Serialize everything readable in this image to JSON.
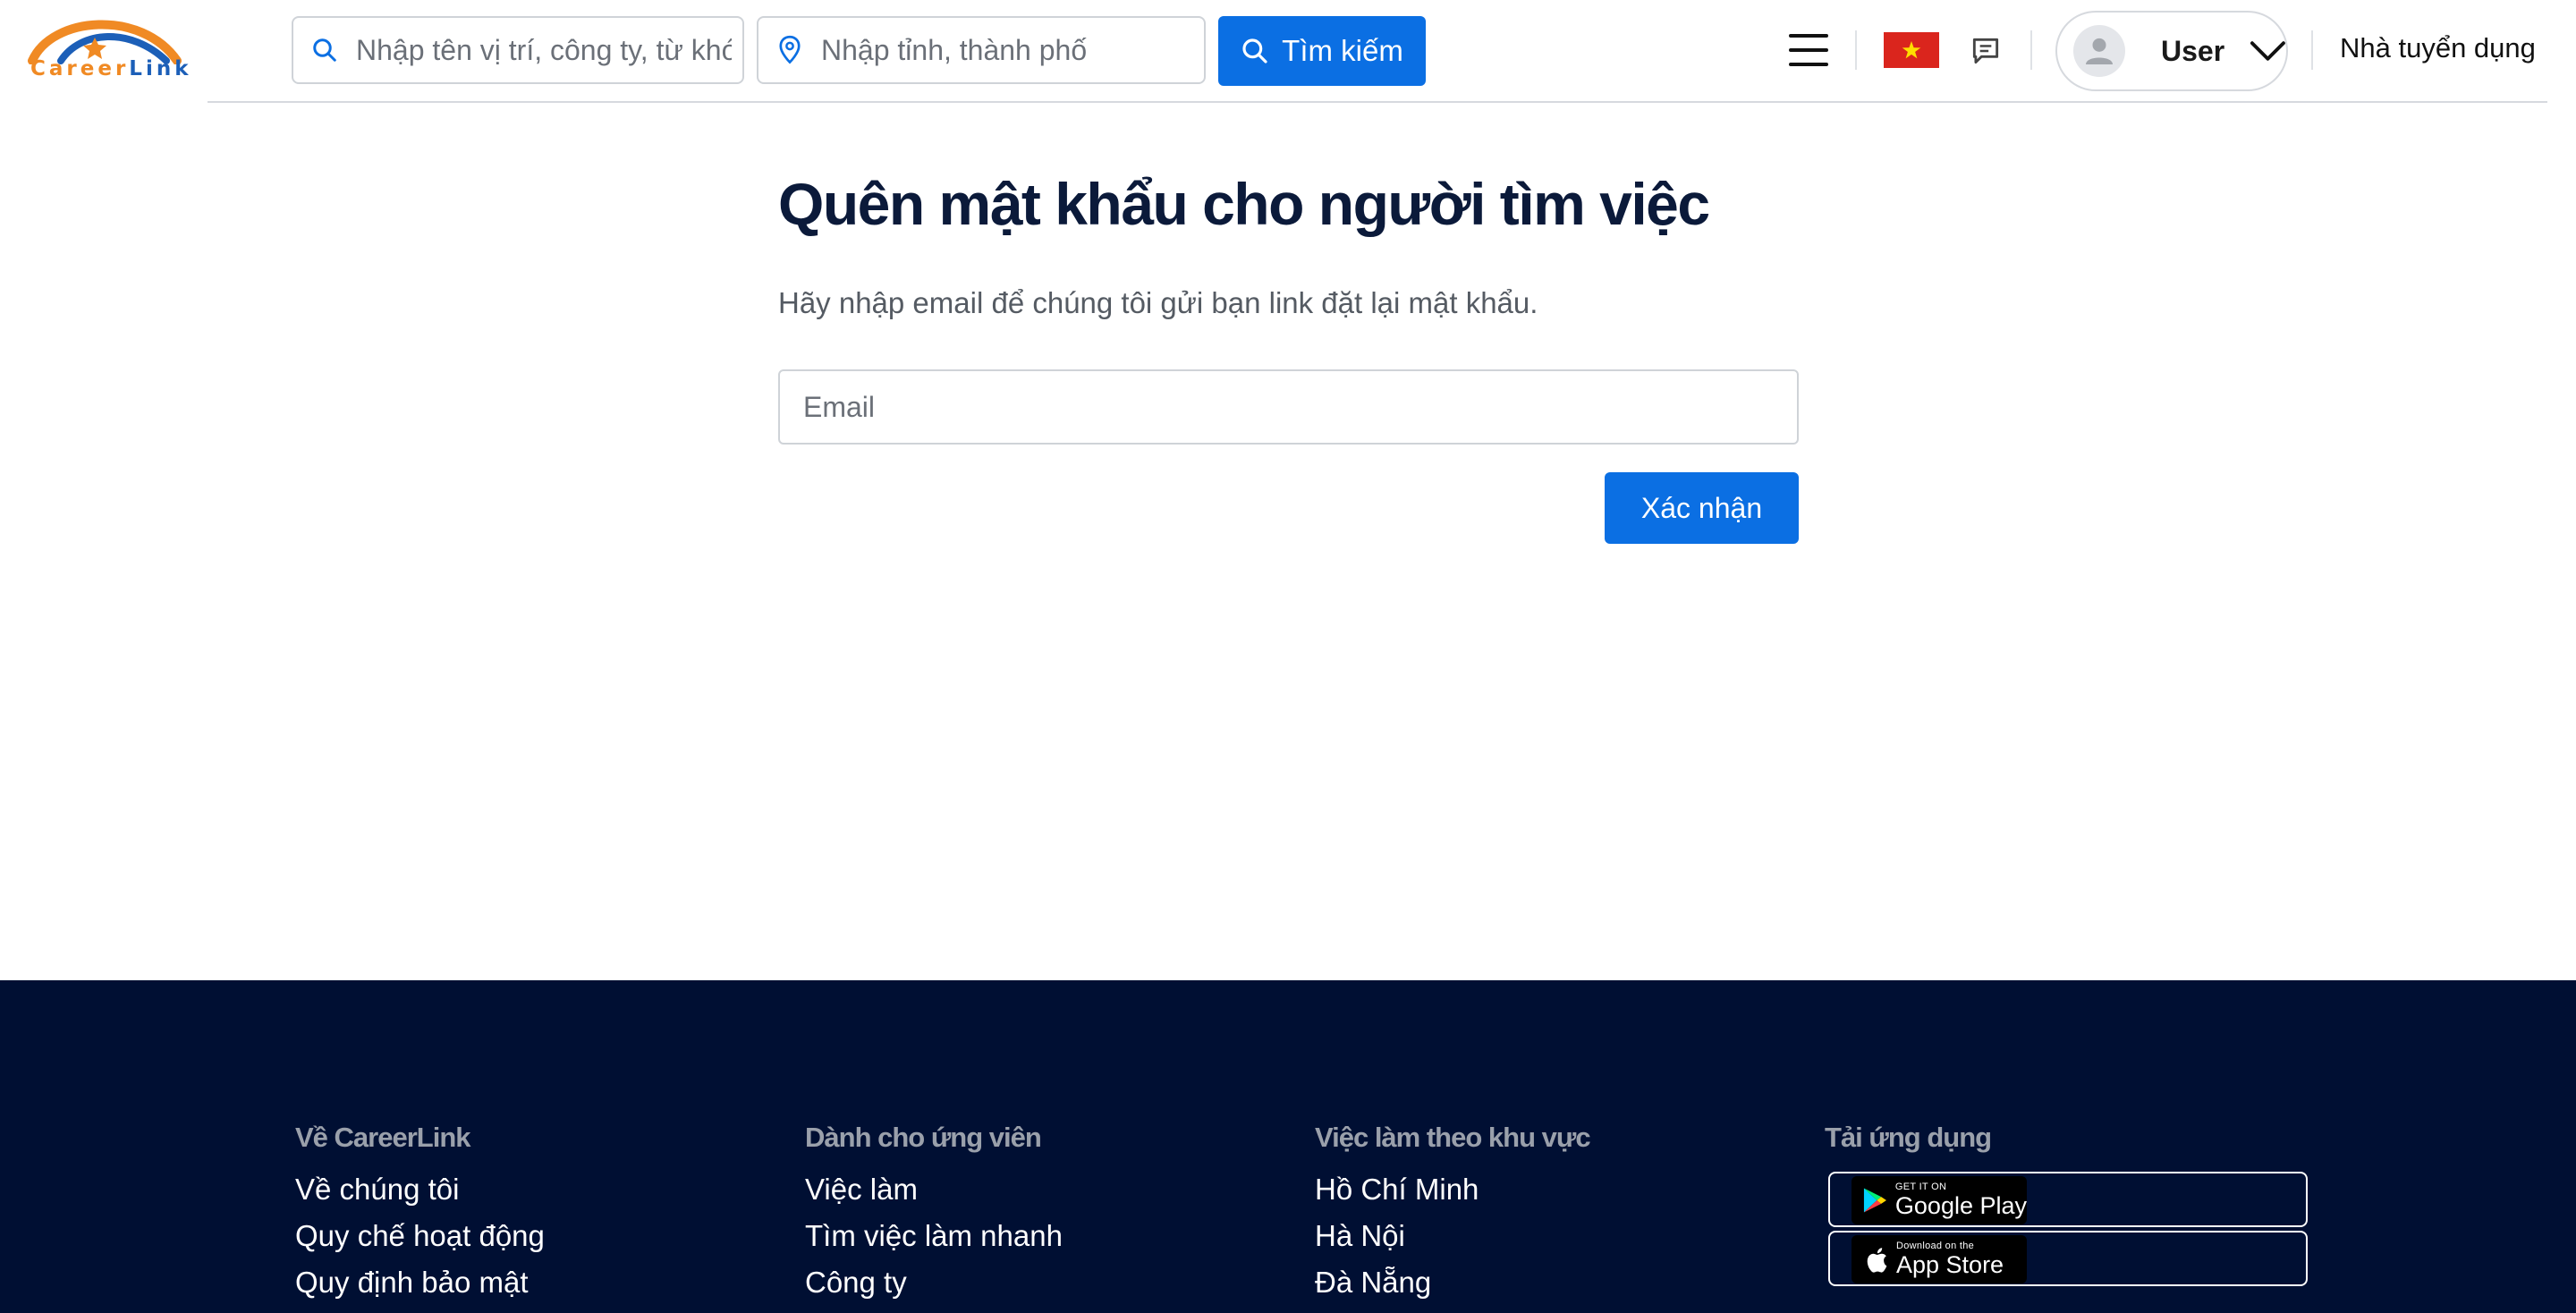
{
  "header": {
    "logo": {
      "part1": "Career",
      "part2": "Link"
    },
    "keyword_search": {
      "placeholder": "Nhập tên vị trí, công ty, từ khóa"
    },
    "location_search": {
      "placeholder": "Nhập tỉnh, thành phố"
    },
    "search_button_label": "Tìm kiếm",
    "language_flag": "vn-flag",
    "user_menu": {
      "name": "User"
    },
    "employer_link": "Nhà tuyển dụng"
  },
  "main": {
    "title": "Quên mật khẩu cho người tìm việc",
    "subtitle": "Hãy nhập email để chúng tôi gửi bạn link đặt lại mật khẩu.",
    "email_field": {
      "placeholder": "Email",
      "value": ""
    },
    "submit_label": "Xác nhận"
  },
  "footer": {
    "columns": [
      {
        "heading": "Về CareerLink",
        "links": [
          "Về chúng tôi",
          "Quy chế hoạt động",
          "Quy định bảo mật"
        ]
      },
      {
        "heading": "Dành cho ứng viên",
        "links": [
          "Việc làm",
          "Tìm việc làm nhanh",
          "Công ty"
        ]
      },
      {
        "heading": "Việc làm theo khu vực",
        "links": [
          "Hồ Chí Minh",
          "Hà Nội",
          "Đà Nẵng"
        ]
      },
      {
        "heading": "Tải ứng dụng",
        "links": []
      }
    ],
    "app_badges": {
      "google_play": {
        "small": "GET IT ON",
        "big": "Google Play"
      },
      "app_store": {
        "small": "Download on the",
        "big": "App Store"
      }
    }
  },
  "colors": {
    "primary_blue": "#0b6fe3",
    "footer_bg": "#000f33",
    "title_navy": "#0b1a3a",
    "logo_orange": "#f08a24",
    "logo_blue": "#1c5fb8"
  }
}
